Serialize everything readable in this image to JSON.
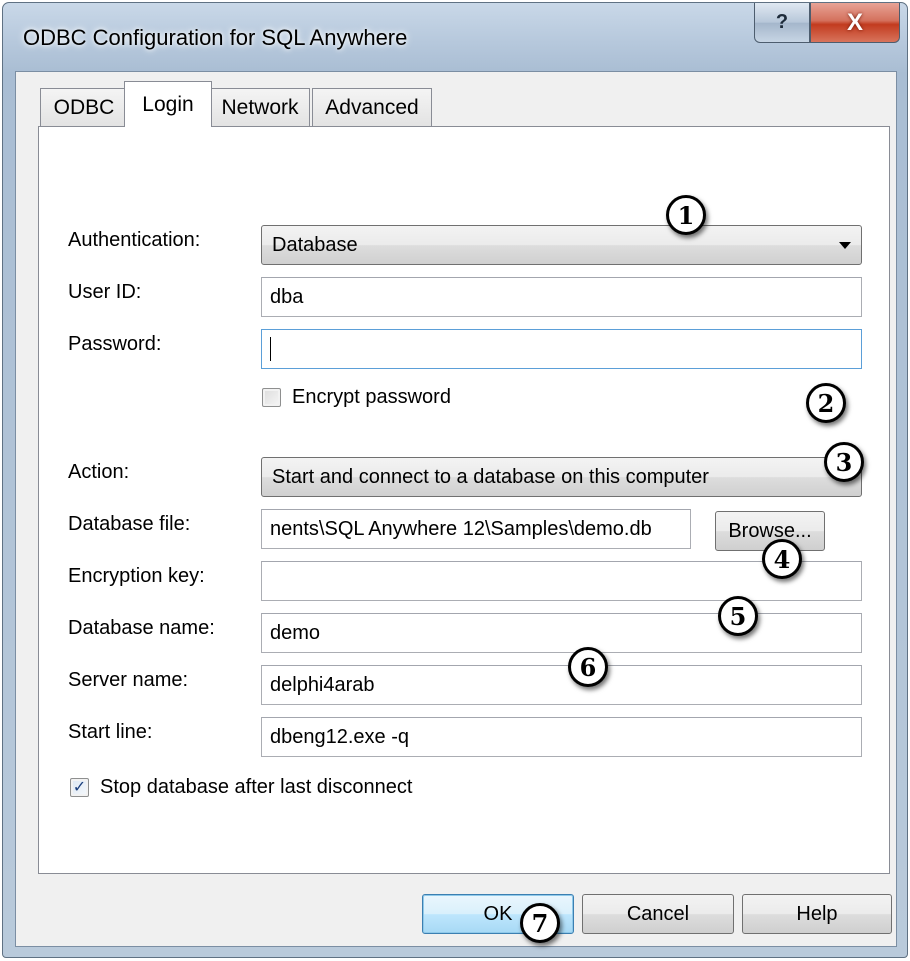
{
  "window": {
    "title": "ODBC Configuration for SQL Anywhere",
    "help_glyph": "?",
    "close_glyph": "X"
  },
  "tabs": [
    {
      "label": "ODBC",
      "active": false
    },
    {
      "label": "Login",
      "active": true
    },
    {
      "label": "Network",
      "active": false
    },
    {
      "label": "Advanced",
      "active": false
    }
  ],
  "login": {
    "authentication_label": "Authentication:",
    "authentication_value": "Database",
    "user_id_label": "User ID:",
    "user_id_value": "dba",
    "password_label": "Password:",
    "password_value": "",
    "encrypt_password_label": "Encrypt password",
    "encrypt_password_checked": false,
    "action_label": "Action:",
    "action_value": "Start and connect to a database on this computer",
    "database_file_label": "Database file:",
    "database_file_value": "nents\\SQL Anywhere 12\\Samples\\demo.db",
    "browse_label": "Browse...",
    "encryption_key_label": "Encryption key:",
    "encryption_key_value": "",
    "database_name_label": "Database name:",
    "database_name_value": "demo",
    "server_name_label": "Server name:",
    "server_name_value": "delphi4arab",
    "start_line_label": "Start line:",
    "start_line_value": "dbeng12.exe -q",
    "stop_database_label": "Stop database after last disconnect",
    "stop_database_checked": true
  },
  "footer": {
    "ok_label": "OK",
    "cancel_label": "Cancel",
    "help_label": "Help"
  },
  "markers": [
    "1",
    "2",
    "3",
    "4",
    "5",
    "6",
    "7"
  ],
  "colors": {
    "title_gradient_top": "#c9d8e8",
    "close_button": "#c23b1f",
    "focus_border": "#5b9fd8",
    "default_button_border": "#3c7fb1"
  }
}
